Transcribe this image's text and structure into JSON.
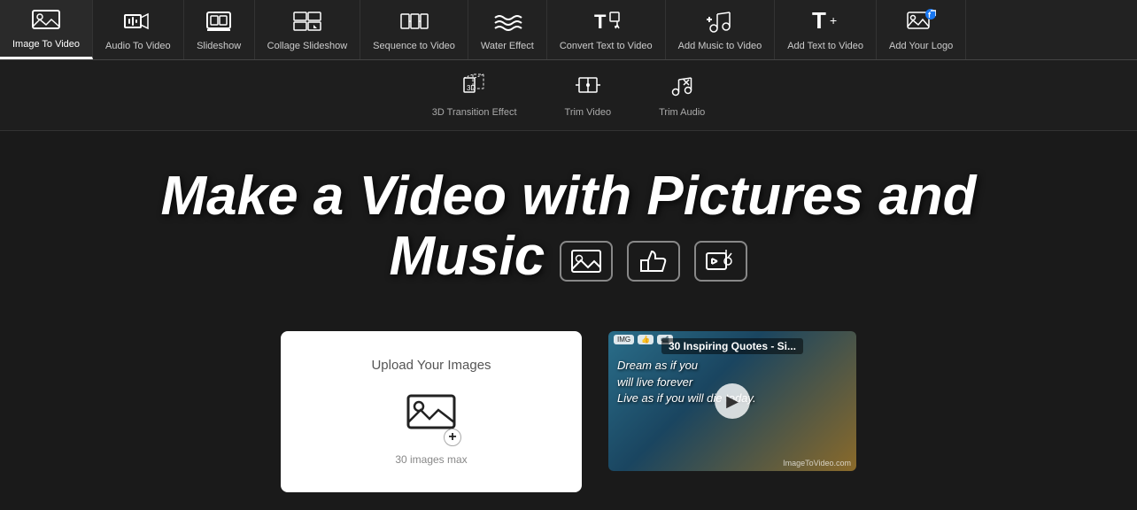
{
  "nav": {
    "items": [
      {
        "id": "image-to-video",
        "label": "Image To Video",
        "icon": "🖼️",
        "active": true
      },
      {
        "id": "audio-to-video",
        "label": "Audio To Video",
        "icon": "🎵",
        "active": false
      },
      {
        "id": "slideshow",
        "label": "Slideshow",
        "icon": "📽️",
        "active": false
      },
      {
        "id": "collage-slideshow",
        "label": "Collage Slideshow",
        "icon": "🎞️",
        "active": false
      },
      {
        "id": "sequence-to-video",
        "label": "Sequence to Video",
        "icon": "🎬",
        "active": false
      },
      {
        "id": "water-effect",
        "label": "Water Effect",
        "icon": "〰️",
        "active": false
      },
      {
        "id": "convert-text-to-video",
        "label": "Convert Text to Video",
        "icon": "📝",
        "active": false
      },
      {
        "id": "add-music-to-video",
        "label": "Add Music to Video",
        "icon": "🎼",
        "active": false
      },
      {
        "id": "add-text-to-video",
        "label": "Add Text to Video",
        "icon": "T+",
        "active": false
      },
      {
        "id": "add-your-logo",
        "label": "Add Your Logo",
        "icon": "🖼️",
        "active": false
      }
    ]
  },
  "secondary_nav": {
    "items": [
      {
        "id": "3d-transition",
        "label": "3D Transition Effect",
        "icon": "✦"
      },
      {
        "id": "trim-video",
        "label": "Trim Video",
        "icon": "✂"
      },
      {
        "id": "trim-audio",
        "label": "Trim Audio",
        "icon": "✂"
      }
    ]
  },
  "hero": {
    "title_line1": "Make a Video with Pictures and",
    "title_line2": "Music",
    "icons": [
      "image-icon",
      "like-icon",
      "video-icon"
    ]
  },
  "upload": {
    "title": "Upload Your Images",
    "limit_text": "30 images max",
    "icon": "image-upload"
  },
  "video_preview": {
    "title": "30 Inspiring Quotes - Si...",
    "quote_line1": "Dream as if you",
    "quote_line2": "will live forever",
    "quote_line3": "Live as if you will die today.",
    "watermark": "ImageToVideo.com"
  }
}
